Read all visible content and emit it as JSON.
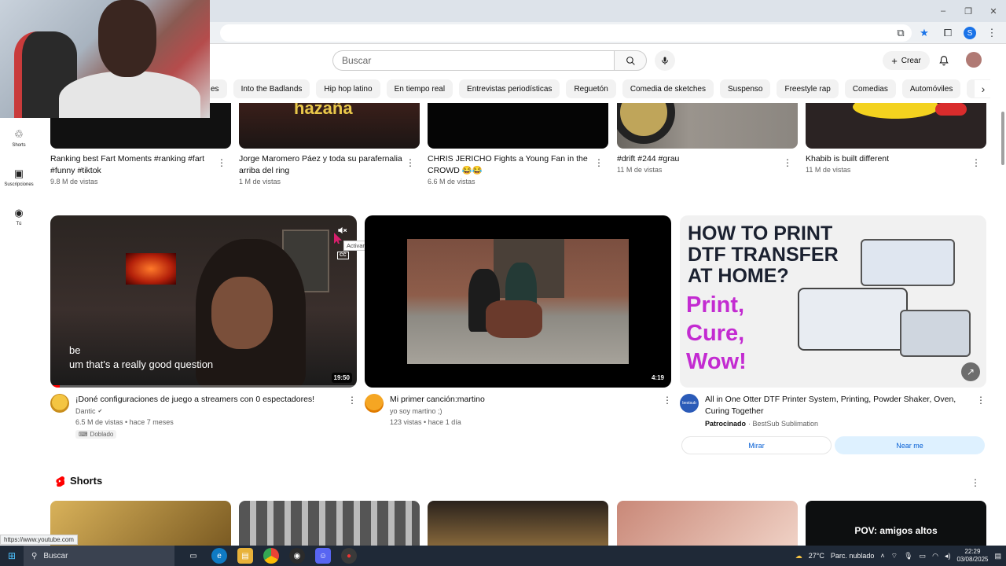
{
  "browser": {
    "minimize": "–",
    "maximize": "❐",
    "close": "✕",
    "profile_initial": "S"
  },
  "masthead": {
    "search_placeholder": "Buscar",
    "create_label": "Crear"
  },
  "chips": [
    "es",
    "Into the Badlands",
    "Hip hop latino",
    "En tiempo real",
    "Entrevistas periodísticas",
    "Reguetón",
    "Comedia de sketches",
    "Suspenso",
    "Freestyle rap",
    "Comedias",
    "Automóviles",
    "Subidos recientemente"
  ],
  "sidebar": [
    {
      "label": "Shorts",
      "icon": "shorts-icon"
    },
    {
      "label": "Suscripciones",
      "icon": "subscriptions-icon"
    },
    {
      "label": "Tú",
      "icon": "you-icon"
    }
  ],
  "row1": [
    {
      "title": "Ranking best Fart Moments #ranking #fart #funny #tiktok",
      "meta": "9.8 M de vistas",
      "thumb_color": "#111111"
    },
    {
      "title": "Jorge Maromero Páez y toda su parafernalia arriba del ring",
      "meta": "1 M de vistas",
      "thumb_color": "#1b1514",
      "thumb_text": "hazaña"
    },
    {
      "title": "CHRIS JERICHO Fights a Young Fan in the CROWD 😂😂",
      "meta": "6.6 M de vistas",
      "thumb_color": "#050505"
    },
    {
      "title": "#drift #244 #grau",
      "meta": "11 M de vistas",
      "thumb_color": "#8b8680"
    },
    {
      "title": "Khabib is built different",
      "meta": "11 M de vistas",
      "thumb_color": "#2b2323"
    }
  ],
  "row2": [
    {
      "title": "¡Doné configuraciones de juego a streamers con 0 espectadores!",
      "channel": "Dantic",
      "verified": "✔",
      "meta": "6.5 M de vistas • hace 7 meses",
      "badge": "Doblado",
      "duration": "19:50",
      "caption_1": "be",
      "caption_2": "um that's a really good question",
      "mute_tooltip": "Activar sonido",
      "cc_label": "CC"
    },
    {
      "title": "Mi primer canción:martino",
      "channel": "yo soy martino ;)",
      "meta": "123 vistas • hace 1 día",
      "duration": "4:19"
    },
    {
      "title": "All in One Otter DTF Printer System, Printing, Powder Shaker, Oven, Curing Together",
      "sponsored": "Patrocinado",
      "advertiser": "· BestSub Sublimation",
      "ad_headline": "HOW TO PRINT DTF TRANSFER AT HOME?",
      "ad_lines": [
        "Print,",
        "Cure,",
        "Wow!"
      ],
      "btn_watch": "Mirar",
      "btn_near": "Near me",
      "advertiser_logo_text": "bestsub"
    }
  ],
  "shorts": {
    "heading": "Shorts",
    "last_overlay": "POV: amigos altos"
  },
  "status_url": "https://www.youtube.com",
  "taskbar": {
    "search": "Buscar",
    "temperature": "27°C",
    "weather": "Parc. nublado",
    "time": "22:29",
    "date": "03/08/2025"
  }
}
